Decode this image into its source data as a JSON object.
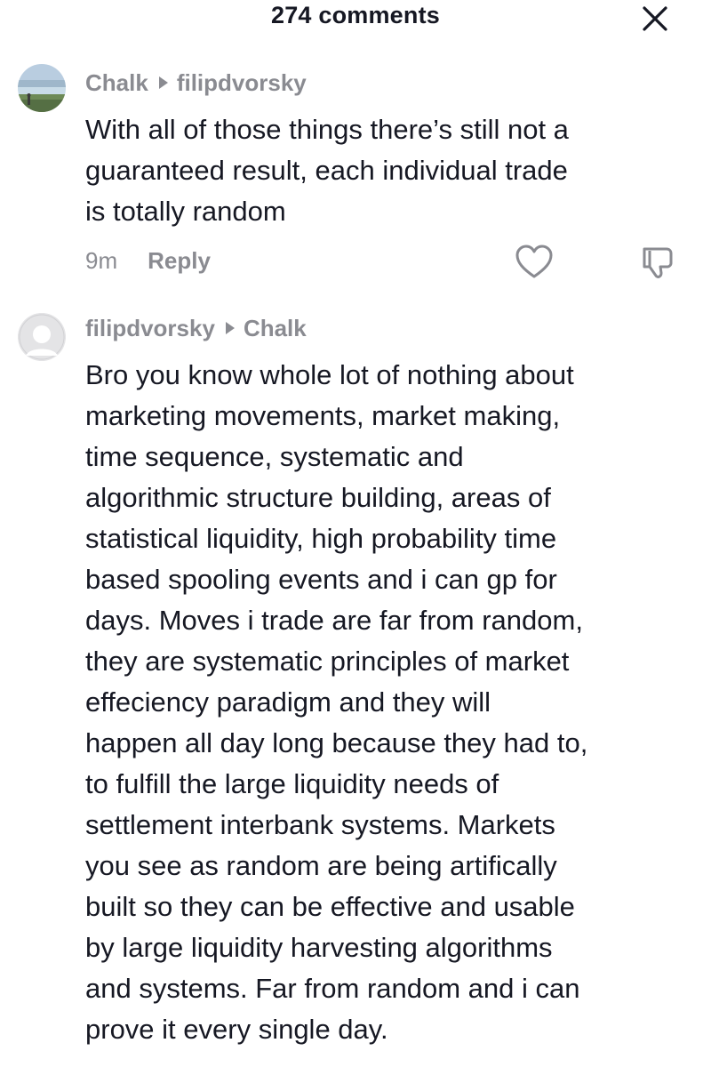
{
  "header": {
    "title": "274 comments",
    "close_icon": "close-icon"
  },
  "comments": [
    {
      "author": "Chalk",
      "reply_to": "filipdvorsky",
      "text_lines": [
        "With all of those things there’s still not a",
        "guaranteed result, each individual trade",
        "is totally random"
      ],
      "time": "9m",
      "reply_label": "Reply",
      "like_icon": "heart-icon",
      "dislike_icon": "thumbs-down-icon",
      "avatar": "landscape-avatar"
    },
    {
      "author": "filipdvorsky",
      "reply_to": "Chalk",
      "text_lines": [
        "Bro you know whole lot of nothing about",
        "marketing movements, market making,",
        "time sequence, systematic and",
        "algorithmic structure building, areas of",
        "statistical liquidity, high probability time",
        "based spooling events and i can gp for",
        "days. Moves i trade are far from random,",
        "they are systematic principles of market",
        "effeciency paradigm and they will",
        "happen all day long because they had to,",
        "to fulfill the large liquidity needs of",
        "settlement interbank systems. Markets",
        "you see as random are being artifically",
        "built so they can be effective and usable",
        "by large liquidity harvesting algorithms",
        "and systems. Far from random and i can",
        "prove it every single day."
      ],
      "avatar": "default-user-avatar"
    }
  ],
  "colors": {
    "text": "#161823",
    "muted": "#8a8b91",
    "background": "#ffffff"
  }
}
